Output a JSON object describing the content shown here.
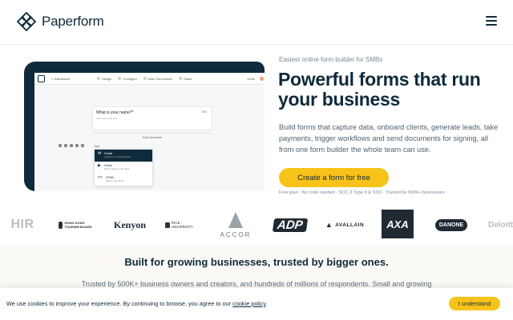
{
  "header": {
    "logo_icon": "paperform-logo-icon",
    "logo_text": "Paperform",
    "menu_icon": "hamburger-icon"
  },
  "hero_mock": {
    "nav_back": "< Dashboard",
    "nav_items": [
      "Design",
      "Configure",
      "After Submission",
      "Share"
    ],
    "nav_right": "Invite",
    "question_title": "What is your name?*",
    "question_hint": "Add some help text",
    "question_required": "Text",
    "add_question": "Add Question",
    "type_label": "Type",
    "dropdown_items": [
      {
        "icon": "✉",
        "title": "Email",
        "subtitle": "Collect an email address"
      },
      {
        "icon": "▶",
        "title": "Video",
        "subtitle": "Add a video to the page"
      },
      {
        "icon": "<>",
        "title": "HTML",
        "subtitle": "Add a code block"
      }
    ]
  },
  "hero": {
    "eyebrow": "Easiest online form builder for SMBs",
    "headline": "Powerful forms that run your business",
    "subcopy": "Build forms that capture data, onboard clients, generate leads, take payments, trigger workflows and send documents for signing, all from one form builder the whole team can use.",
    "cta_label": "Create a form for free",
    "fineprint": "Free plan · No code needed · SOC 2 Type II & SSO · Trusted by 500K+ businesses"
  },
  "logos": {
    "hir": "HIR",
    "hk": "HONG KONG TOURISM BOARD",
    "kenyon": "Kenyon",
    "rice": "RICE UNIVERSITY",
    "accor": "ACCOR",
    "adp": "ADP",
    "avallain": "AVALLAIN",
    "axa": "AXA",
    "danone": "DANONE",
    "deloitte": "Deloitte"
  },
  "section": {
    "title": "Built for growing businesses, trusted by bigger ones.",
    "subtitle": "Trusted by 500K+ business owners and creators, and hundreds of millions of respondents. Small and growing"
  },
  "cookie": {
    "text_before": "We use cookies to improve your experience. By continuing to browse, you agree to our ",
    "link": "cookie policy",
    "text_after": ".",
    "button": "I understand"
  }
}
